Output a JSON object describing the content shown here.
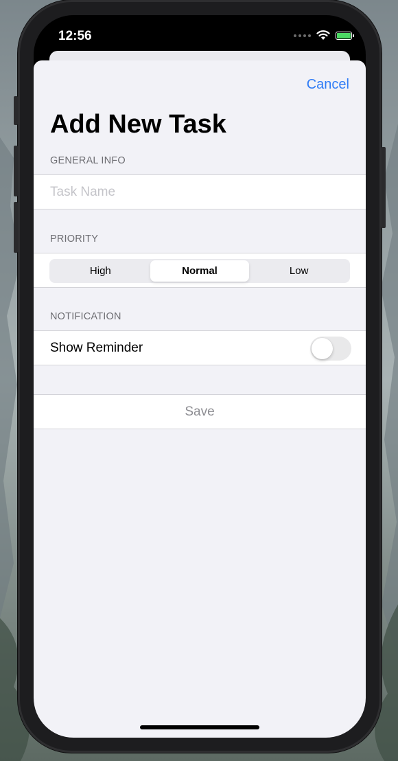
{
  "status_bar": {
    "time": "12:56"
  },
  "header": {
    "cancel_label": "Cancel",
    "title": "Add New Task"
  },
  "general_info": {
    "header": "GENERAL INFO",
    "task_name_value": "",
    "task_name_placeholder": "Task Name"
  },
  "priority": {
    "header": "PRIORITY",
    "options": [
      "High",
      "Normal",
      "Low"
    ],
    "selected": "Normal"
  },
  "notification": {
    "header": "NOTIFICATION",
    "reminder_label": "Show Reminder",
    "reminder_enabled": false
  },
  "actions": {
    "save_label": "Save"
  },
  "colors": {
    "accent": "#2f7cf6",
    "background": "#f2f2f7",
    "battery": "#4cd964"
  },
  "icons": [
    "wifi-icon",
    "battery-icon",
    "cellular-signal-icon"
  ]
}
